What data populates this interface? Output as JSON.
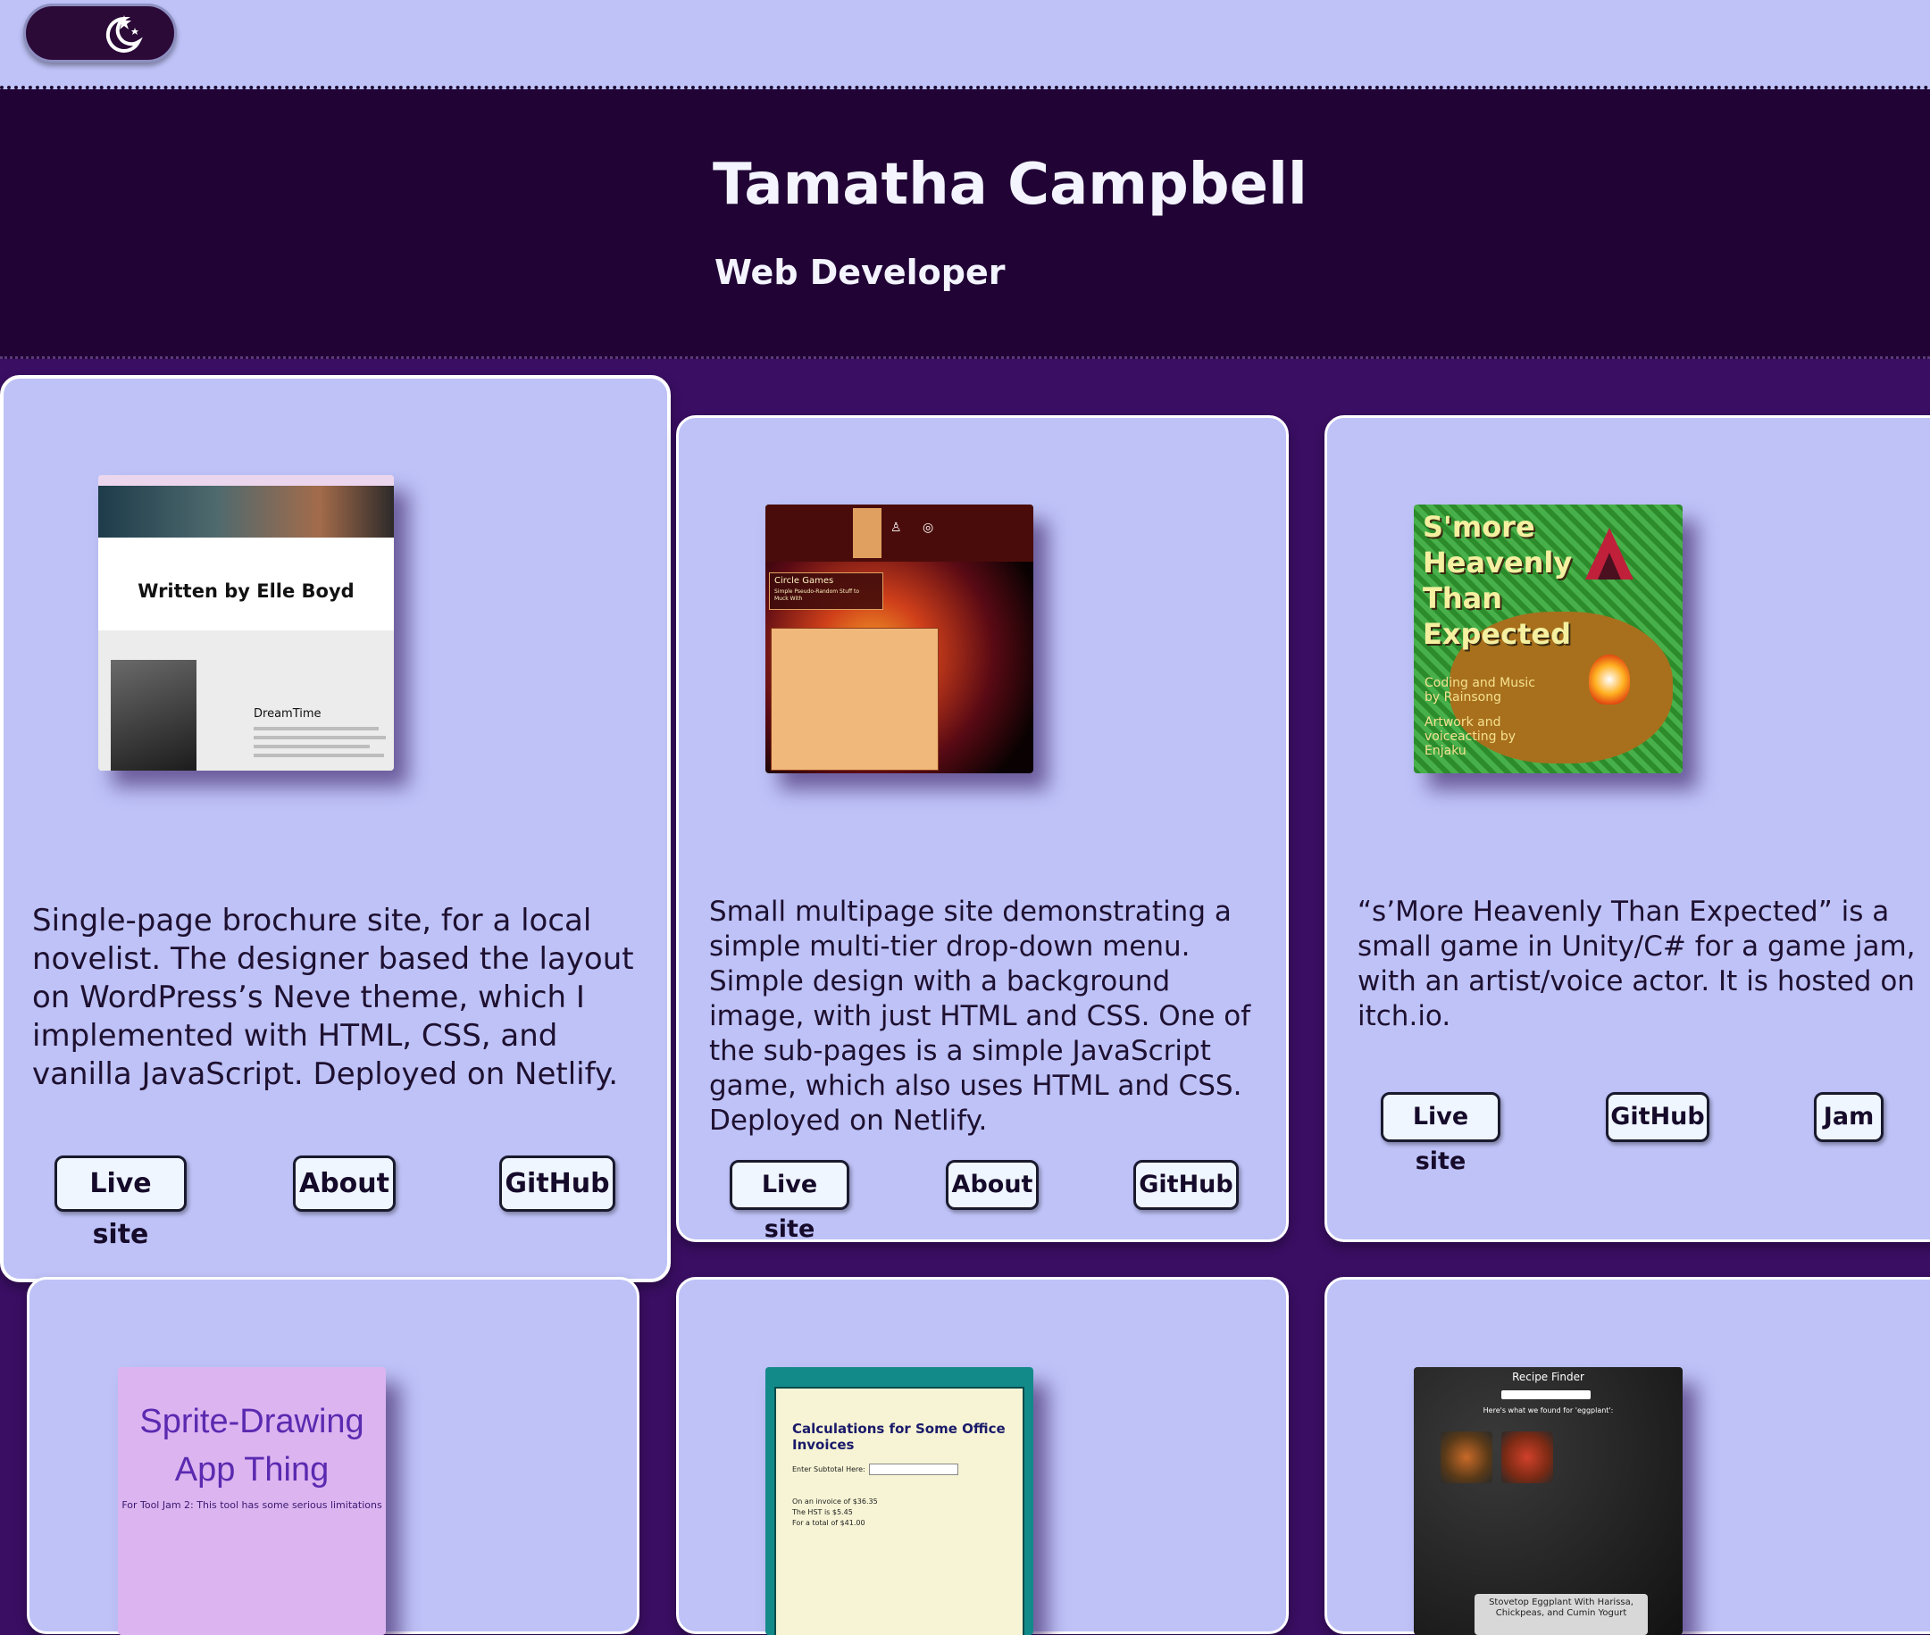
{
  "theme_toggle": {
    "icon": "moon-stars-icon"
  },
  "header": {
    "name": "Tamatha Campbell",
    "role": "Web Developer"
  },
  "projects": [
    {
      "preview_title": "Written by Elle Boyd",
      "preview_subtitle": "DreamTime",
      "description": "Single-page brochure site, for a local novelist. The designer based the layout on WordPress’s Neve theme, which I implemented with HTML, CSS, and vanilla JavaScript. Deployed on Netlify.",
      "buttons": [
        "Live site",
        "About",
        "GitHub"
      ]
    },
    {
      "preview_title": "Circle Games",
      "preview_subtitle": "Simple Pseudo-Random Stuff to Muck With",
      "description": "Small multipage site demonstrating a simple multi-tier drop-down menu. Simple design with a background image, with just HTML and CSS. One of the sub-pages is a simple JavaScript game, which also uses HTML and CSS. Deployed on Netlify.",
      "buttons": [
        "Live site",
        "About",
        "GitHub"
      ]
    },
    {
      "preview_title_lines": [
        "S'more",
        "Heavenly",
        "Than",
        "Expected"
      ],
      "preview_credit1": "Coding and Music by Rainsong",
      "preview_credit2": "Artwork and voiceacting by Enjaku",
      "description": "“s’More Heavenly Than Expected” is a small game in Unity/C# for a game jam, with an artist/voice actor. It is hosted on itch.io.",
      "buttons": [
        "Live site",
        "GitHub",
        "Jam"
      ]
    },
    {
      "preview_title_lines": [
        "Sprite-Drawing",
        "App Thing"
      ],
      "preview_subtitle": "For Tool Jam 2: This tool has some serious limitations"
    },
    {
      "preview_title": "Calculations for Some Office Invoices",
      "preview_line1": "Enter Subtotal Here:",
      "preview_values": [
        "On an invoice of $36.35",
        "The HST is $5.45",
        "For a total of $41.00"
      ]
    },
    {
      "preview_title": "Recipe Finder",
      "preview_subtitle": "Here's what we found for 'eggplant':",
      "preview_caption": "Stovetop Eggplant With Harissa, Chickpeas, and Cumin Yogurt"
    }
  ]
}
